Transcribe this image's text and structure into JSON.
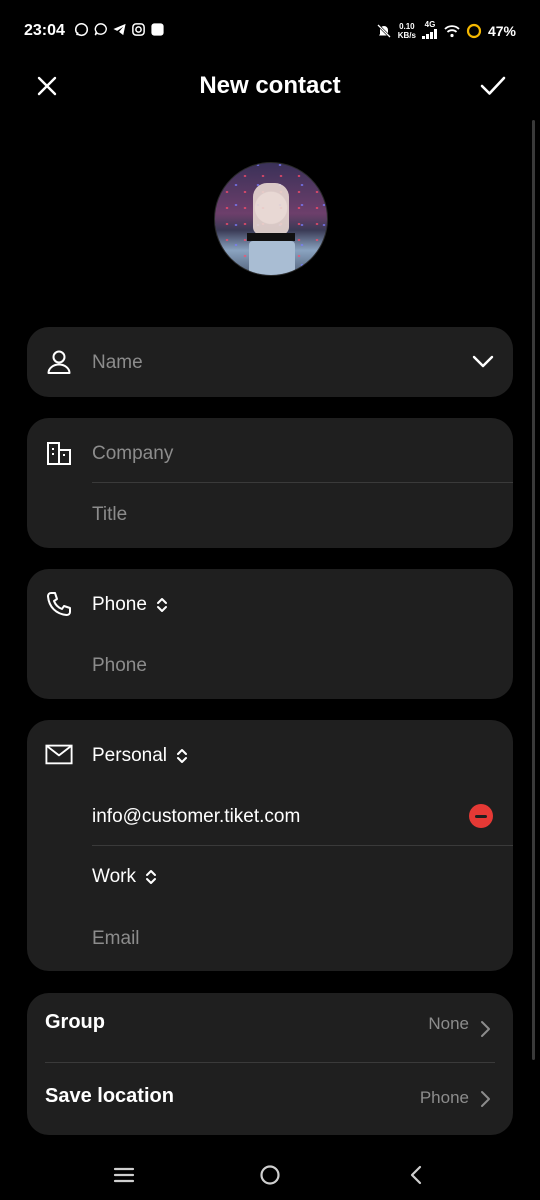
{
  "status_bar": {
    "time": "23:04",
    "network_speed": "0.10",
    "network_unit": "KB/s",
    "signal_type": "4G",
    "battery": "47%"
  },
  "header": {
    "title": "New contact",
    "cancel_icon": "close-icon",
    "confirm_icon": "check-icon"
  },
  "name_section": {
    "placeholder": "Name"
  },
  "company_section": {
    "company_placeholder": "Company",
    "title_placeholder": "Title"
  },
  "phone_section": {
    "label": "Phone",
    "placeholder": "Phone"
  },
  "email_section": {
    "label_1": "Personal",
    "value_1": "info@customer.tiket.com",
    "label_2": "Work",
    "placeholder": "Email"
  },
  "settings": [
    {
      "label": "Group",
      "value": "None"
    },
    {
      "label": "Save location",
      "value": "Phone"
    }
  ],
  "colors": {
    "background": "#000000",
    "card": "#1f1f1f",
    "placeholder": "#8c8c8c",
    "delete": "#e53935"
  }
}
